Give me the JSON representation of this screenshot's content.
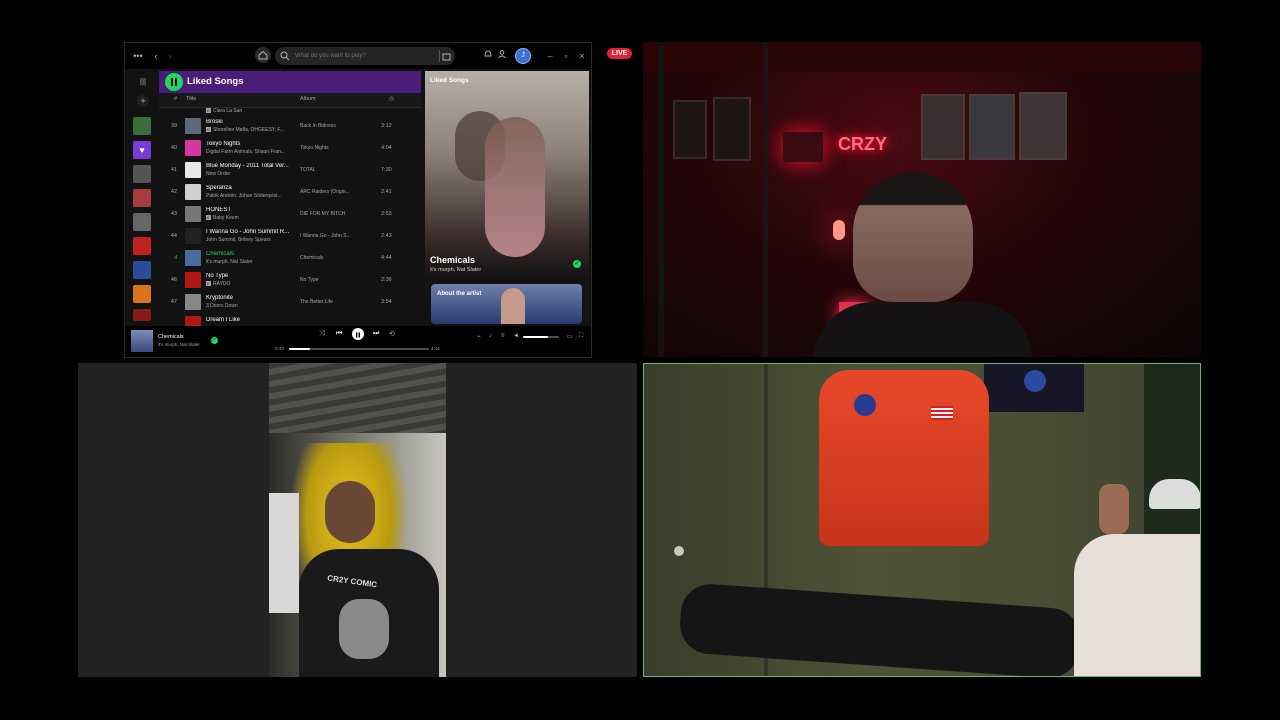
{
  "live_badge": "LIVE",
  "spotify": {
    "search_placeholder": "What do you want to play?",
    "avatar_initial": "J",
    "playlist_title": "Liked Songs",
    "columns": {
      "num": "#",
      "title": "Title",
      "album": "Album"
    },
    "partial_top_artist": "Clara La San",
    "rows": [
      {
        "num": "39",
        "title": "Broski",
        "artist": "Shoreline Mafia, OHGEESY, F...",
        "album": "Back In Bidness",
        "duration": "3:12",
        "explicit": true,
        "color": "#5a6a7a"
      },
      {
        "num": "40",
        "title": "Tokyo Nights",
        "artist": "Digital Farm Animals, Shaun Fran...",
        "album": "Tokyo Nights",
        "duration": "4:04",
        "explicit": false,
        "color": "#d23aa0"
      },
      {
        "num": "41",
        "title": "Blue Monday - 2011 Total Ver...",
        "artist": "New Order",
        "album": "TOTAL",
        "duration": "7:30",
        "explicit": false,
        "color": "#e8e8e8"
      },
      {
        "num": "42",
        "title": "Speranza",
        "artist": "Patrik Andrén, Johan Söderqvist...",
        "album": "ARC Raiders (Origin...",
        "duration": "2:41",
        "explicit": false,
        "color": "#cfcfcf"
      },
      {
        "num": "43",
        "title": "HONEST",
        "artist": "Baby Keem",
        "album": "DIE FOR MY BITCH",
        "duration": "2:53",
        "explicit": true,
        "color": "#777"
      },
      {
        "num": "44",
        "title": "I Wanna Go - John Summit R...",
        "artist": "John Summit, Britney Spears",
        "album": "I Wanna Go - John S...",
        "duration": "2:43",
        "explicit": false,
        "color": "#222"
      },
      {
        "num": "",
        "title": "Chemicals",
        "artist": "it's murph, Nat Slater",
        "album": "Chemicals",
        "duration": "4:44",
        "explicit": false,
        "color": "#4a6b9a",
        "active": true
      },
      {
        "num": "46",
        "title": "No Type",
        "artist": "RAYDO",
        "album": "No Type",
        "duration": "2:36",
        "explicit": true,
        "color": "#b01818"
      },
      {
        "num": "47",
        "title": "Kryptonite",
        "artist": "3 Doors Down",
        "album": "The Better Life",
        "duration": "3:54",
        "explicit": false,
        "color": "#888"
      },
      {
        "num": "",
        "title": "Dream I Like",
        "artist": "",
        "album": "",
        "duration": "",
        "explicit": false,
        "color": "#b01818"
      }
    ],
    "right_panel": {
      "header": "Liked Songs",
      "track_title": "Chemicals",
      "track_artist": "it's murph, Nat Slater",
      "about_label": "About the artist"
    },
    "player": {
      "title": "Chemicals",
      "artist": "it's murph, Nat Slater",
      "elapsed": "0:43",
      "total": "4:44",
      "progress": 0.15,
      "volume": 0.7
    },
    "sidebar_thumb_colors": [
      "#3b6d3b",
      "#7a3bd6",
      "#555",
      "#a83b3b",
      "#666",
      "#c02020",
      "#2a4d9a",
      "#d8741c",
      "#8a1a1a"
    ],
    "accent": "#1ed760"
  },
  "tile_colors": {
    "red_room": "#2a070b",
    "dark": "#222222",
    "green_room": "#4a4d33",
    "speaker_outline": "#4fbf6a"
  },
  "overlay_text": {
    "shirt_text": "CR2Y COMIC",
    "neon_sign": "CRZY"
  }
}
